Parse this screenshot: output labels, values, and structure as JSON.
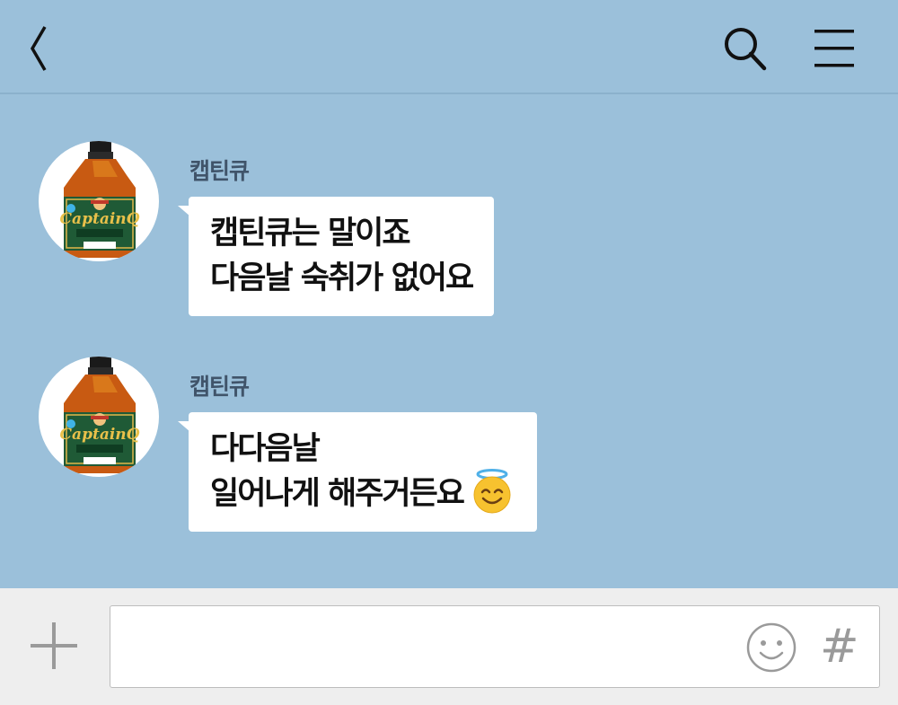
{
  "header": {
    "back_icon": "back-chevron-icon",
    "search_icon": "search-icon",
    "menu_icon": "hamburger-menu-icon"
  },
  "messages": [
    {
      "sender": "캡틴큐",
      "avatar_icon": "captain-q-bottle-avatar",
      "lines": [
        "캡틴큐는 말이죠",
        "다음날 숙취가 없어요"
      ]
    },
    {
      "sender": "캡틴큐",
      "avatar_icon": "captain-q-bottle-avatar",
      "lines": [
        "다다음날",
        "일어나게 해주거든요"
      ],
      "emoji": "smiling-face-with-halo-emoji"
    }
  ],
  "composer": {
    "plus_icon": "plus-icon",
    "input_value": "",
    "emoji_icon": "smiley-icon",
    "hash_label": "#"
  },
  "colors": {
    "chat_background": "#9bc0da",
    "bubble": "#ffffff",
    "sender_name": "#40546a",
    "composer_background": "#eeeeee"
  }
}
